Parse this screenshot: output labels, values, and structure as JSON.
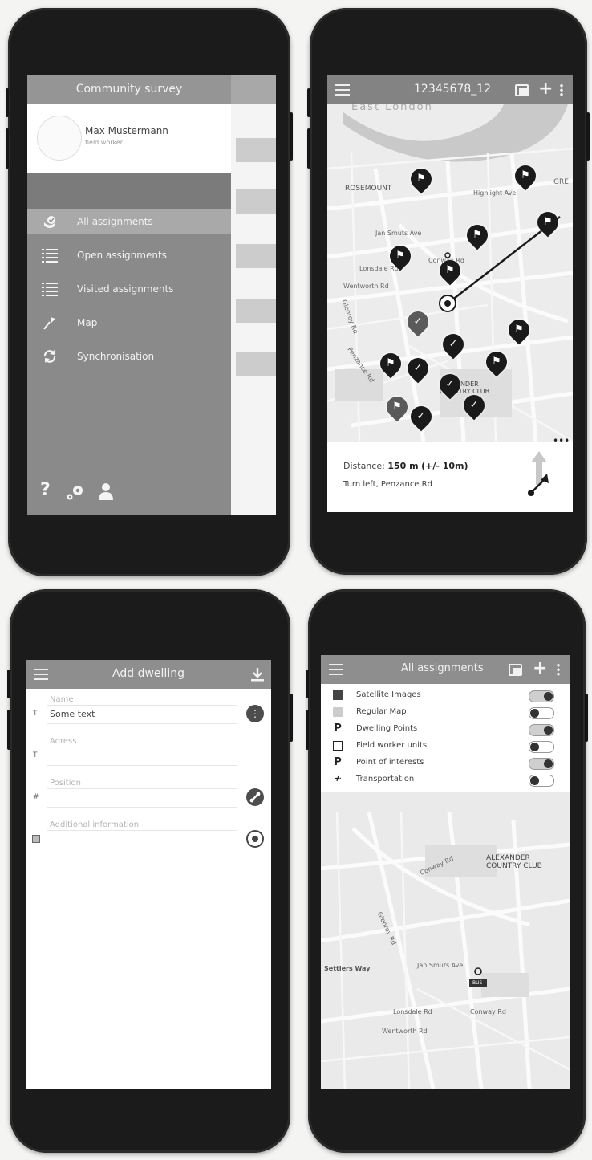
{
  "drawer_screen": {
    "title": "Community survey",
    "user": {
      "name": "Max Mustermann",
      "role": "field worker"
    },
    "menu": [
      {
        "label": "All assignments",
        "icon": "assignments-check-icon",
        "selected": true
      },
      {
        "label": "Open assignments",
        "icon": "list-icon",
        "selected": false
      },
      {
        "label": "Visited assignments",
        "icon": "checklist-icon",
        "selected": false
      },
      {
        "label": "Map",
        "icon": "map-pin-icon",
        "selected": false
      },
      {
        "label": "Synchronisation",
        "icon": "sync-icon",
        "selected": false
      }
    ],
    "footer_icons": [
      "help-icon",
      "settings-icon",
      "profile-icon"
    ],
    "help_glyph": "?"
  },
  "map_screen": {
    "title": "12345678_12",
    "area_label": "East London",
    "labels": {
      "rosemount": "ROSEMOUNT",
      "gre": "GRE",
      "highlight_ave": "Highlight Ave",
      "jan_smuts": "Jan Smuts Ave",
      "conway": "Conway Rd",
      "lonsdale": "Lonsdale Rd",
      "wentworth": "Wentworth Rd",
      "glenroy": "Glenroy Rd",
      "penzance": "Penzance Rd",
      "club": "ALEXANDER COUNTRY CLUB"
    },
    "distance_label": "Distance:",
    "distance_value": "150 m",
    "distance_tolerance": "(+/- 10m)",
    "instruction": "Turn left, Penzance Rd",
    "more_glyph": "•••"
  },
  "form_screen": {
    "title": "Add dwelling",
    "fields": [
      {
        "label": "Name",
        "type_glyph": "T",
        "value": "Some text",
        "action_icon": "more-options-icon"
      },
      {
        "label": "Adress",
        "type_glyph": "T",
        "value": "",
        "action_icon": ""
      },
      {
        "label": "Position",
        "type_glyph": "#",
        "value": "",
        "action_icon": "gps-icon"
      },
      {
        "label": "Additional information",
        "type_glyph": "",
        "value": "",
        "action_icon": "camera-icon"
      }
    ]
  },
  "layers_screen": {
    "title": "All assignments",
    "layers": [
      {
        "label": "Satellite Images",
        "icon": "satellite-icon",
        "on": true
      },
      {
        "label": "Regular Map",
        "icon": "map-icon",
        "on": false
      },
      {
        "label": "Dwelling Points",
        "icon": "dwelling-point-icon",
        "glyph": "P",
        "on": true
      },
      {
        "label": "Field worker units",
        "icon": "unit-square-icon",
        "on": false
      },
      {
        "label": "Point of interests",
        "icon": "poi-icon",
        "glyph": "P",
        "on": true
      },
      {
        "label": "Transportation",
        "icon": "transport-icon",
        "glyph": "≁",
        "on": false
      }
    ],
    "map_labels": {
      "club": "ALEXANDER COUNTRY CLUB",
      "conway": "Conway Rd",
      "jan_smuts": "Jan Smuts Ave",
      "lonsdale": "Lonsdale Rd",
      "wentworth": "Wentworth Rd",
      "glenroy": "Glenroy Rd",
      "way": "Settlers Way",
      "bus": "BUS"
    }
  }
}
